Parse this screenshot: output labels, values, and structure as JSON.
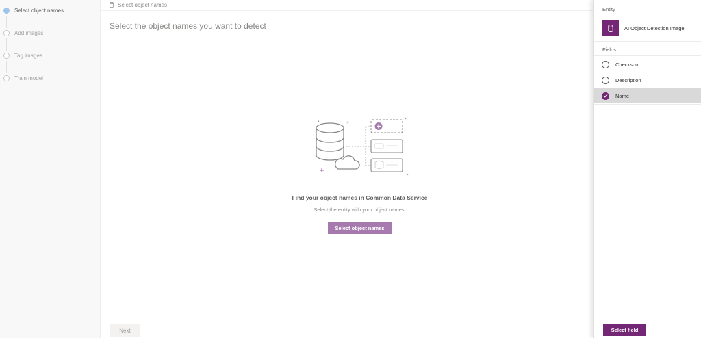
{
  "stepper": {
    "steps": [
      {
        "label": "Select object names",
        "active": true
      },
      {
        "label": "Add images",
        "active": false
      },
      {
        "label": "Tag images",
        "active": false
      },
      {
        "label": "Train model",
        "active": false
      }
    ]
  },
  "main": {
    "breadcrumb": "Select object names",
    "heading": "Select the object names you want to detect",
    "empty_state": {
      "title": "Find your object names in Common Data Service",
      "subtitle": "Select the entity with your object names.",
      "button_label": "Select object names"
    },
    "next_label": "Next"
  },
  "panel": {
    "entity_label": "Entity",
    "entity_name": "AI Object Detection Image",
    "fields_label": "Fields",
    "fields": [
      {
        "name": "Checksum",
        "selected": false
      },
      {
        "name": "Description",
        "selected": false
      },
      {
        "name": "Name",
        "selected": true
      }
    ],
    "select_field_label": "Select field"
  },
  "colors": {
    "brand_purple": "#742774",
    "cta_purple": "#a77aaf",
    "active_step": "#9fc5ea"
  }
}
